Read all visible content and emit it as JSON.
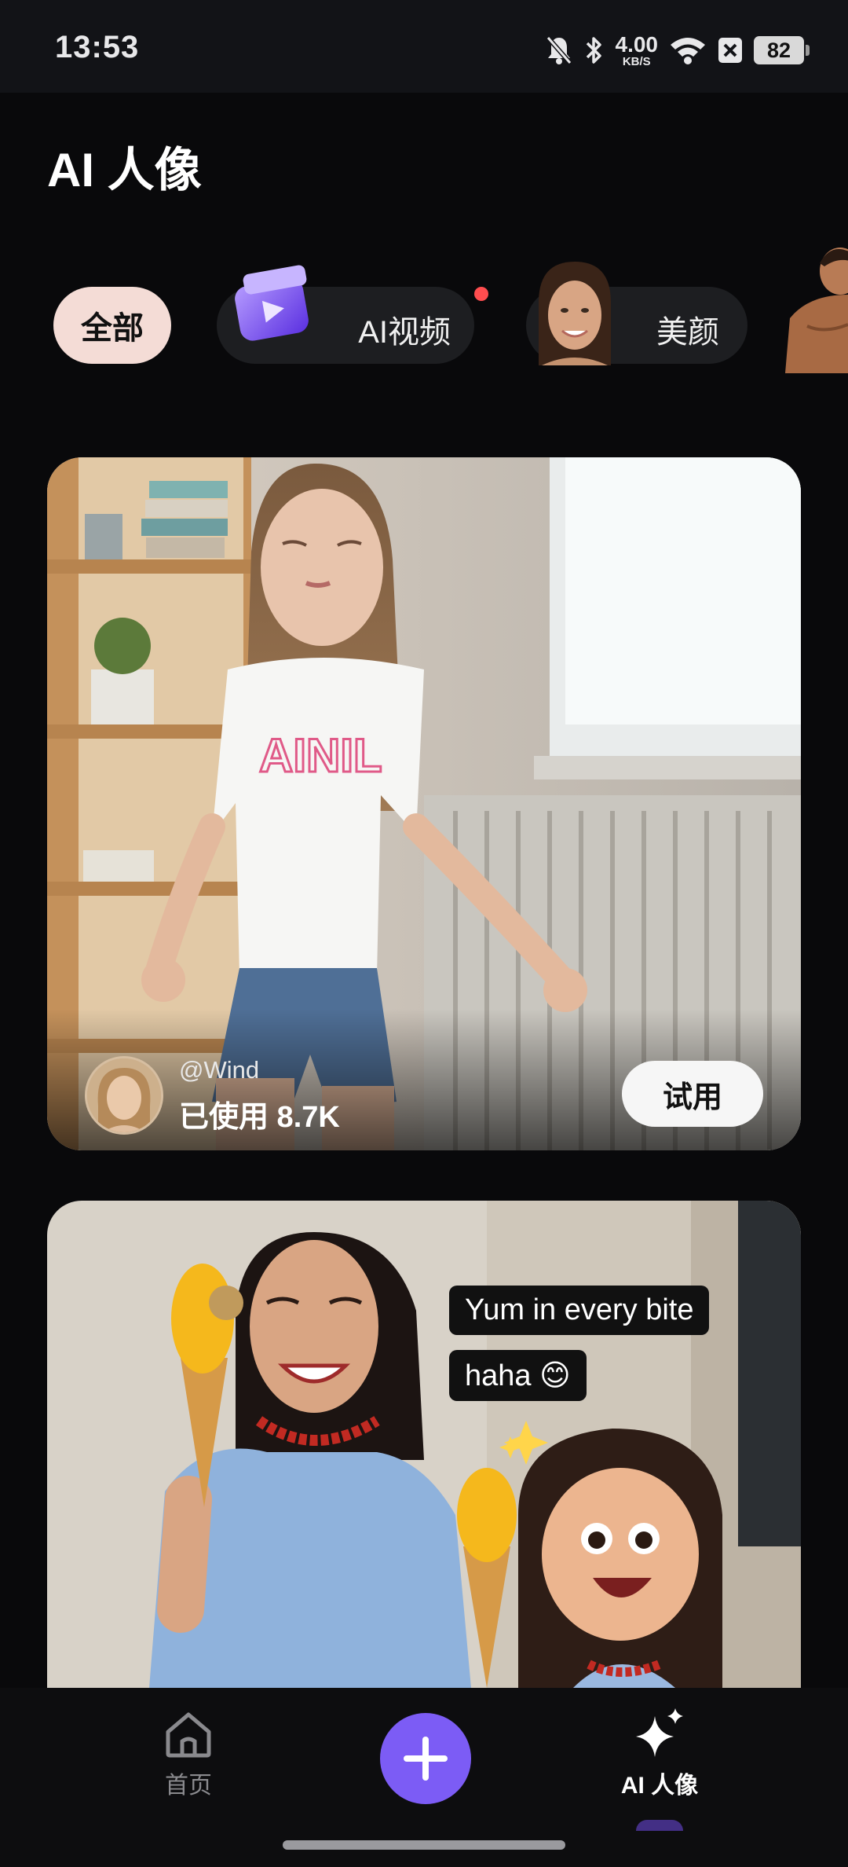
{
  "status_bar": {
    "time": "13:53",
    "net_speed_value": "4.00",
    "net_speed_unit": "KB/S",
    "battery": "82",
    "icons": [
      "mute-bell-icon",
      "bluetooth-icon",
      "wifi-icon",
      "x-box-icon",
      "battery-icon"
    ]
  },
  "header": {
    "title": "AI 人像"
  },
  "categories": {
    "all_label": "全部",
    "video_label": "AI视频",
    "beauty_label": "美颜"
  },
  "cards": [
    {
      "author": "@Wind",
      "usage": "已使用 8.7K",
      "try_label": "试用"
    },
    {
      "captions": [
        "Yum in every bite",
        "haha 😊"
      ]
    }
  ],
  "bottom_nav": {
    "home_label": "首页",
    "ai_label": "AI 人像"
  },
  "colors": {
    "background": "#09090b",
    "accent": "#7c5cf5",
    "chip_active": "#f4dcd6",
    "notification_dot": "#ff4d4f"
  }
}
